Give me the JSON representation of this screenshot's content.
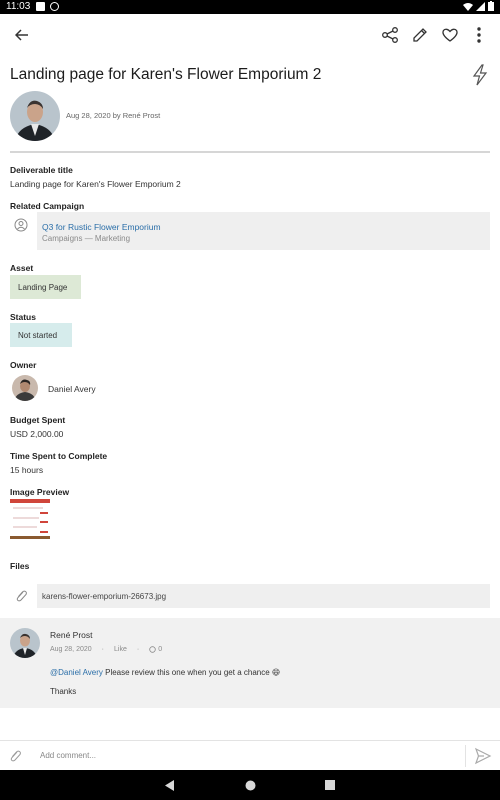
{
  "status_bar": {
    "time": "11:03"
  },
  "deliverable": {
    "title": "Landing page for Karen's Flower Emporium 2",
    "meta": "Aug 28, 2020 by René Prost"
  },
  "fields": {
    "deliverable_title_label": "Deliverable title",
    "deliverable_title_value": "Landing page for Karen's Flower Emporium 2",
    "related_campaign_label": "Related Campaign",
    "campaign_name": "Q3 for Rustic Flower Emporium",
    "campaign_sub": "Campaigns — Marketing",
    "asset_label": "Asset",
    "asset_value": "Landing Page",
    "status_label": "Status",
    "status_value": "Not started",
    "owner_label": "Owner",
    "owner_name": "Daniel Avery",
    "budget_label": "Budget Spent",
    "budget_value": "USD 2,000.00",
    "time_label": "Time Spent to Complete",
    "time_value": "15 hours",
    "image_preview_label": "Image Preview",
    "files_label": "Files",
    "file_name": "karens-flower-emporium-26673.jpg"
  },
  "comment": {
    "author": "René Prost",
    "date": "Aug 28, 2020",
    "like_label": "Like",
    "reply_count": "0",
    "mention": "@Daniel Avery",
    "text": " Please review this one when you get a chance 😄",
    "thanks": "Thanks"
  },
  "composer": {
    "placeholder": "Add comment..."
  },
  "colors": {
    "link": "#2a6ea8",
    "asset_tag": "#dde9d6",
    "status_tag": "#d6ecec",
    "card_bg": "#efefef"
  },
  "icons": [
    "back-arrow-icon",
    "share-icon",
    "edit-icon",
    "heart-icon",
    "more-vert-icon",
    "bolt-icon",
    "person-icon",
    "paperclip-icon",
    "send-icon",
    "reply-icon",
    "nav-back-icon",
    "nav-home-icon",
    "nav-recents-icon"
  ]
}
